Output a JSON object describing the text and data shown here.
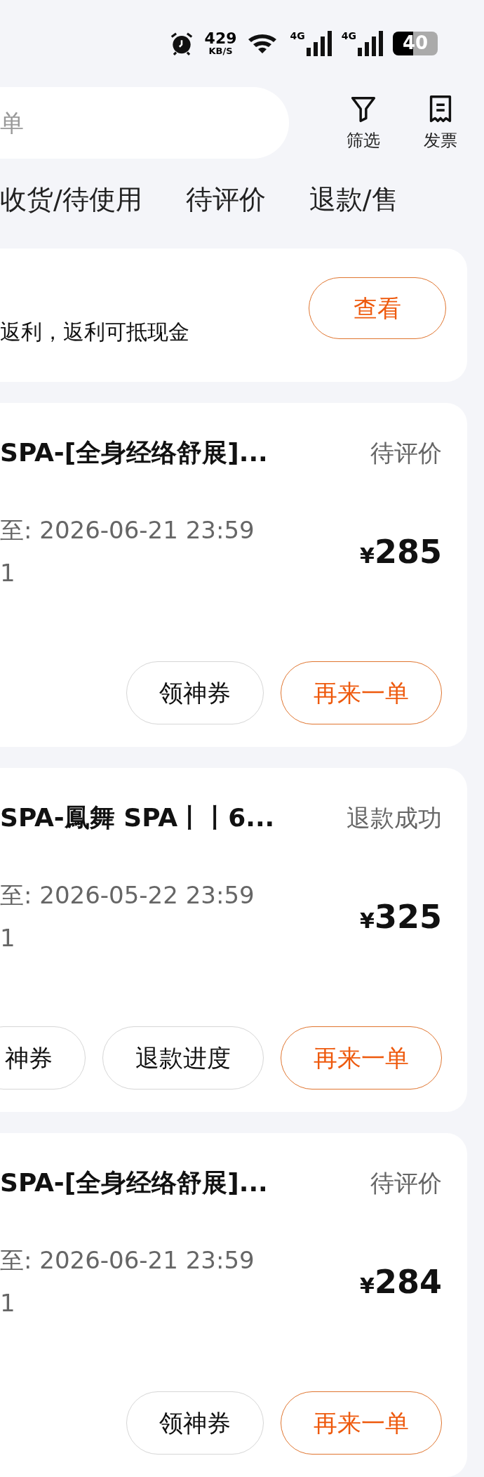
{
  "status_bar": {
    "speed": "429",
    "speed_unit": "KB/S",
    "networks": [
      "4G",
      "4G"
    ],
    "battery": "40"
  },
  "search": {
    "placeholder": "单"
  },
  "actions": [
    {
      "label": "筛选",
      "kind": "filter"
    },
    {
      "label": "发票",
      "kind": "invoice"
    }
  ],
  "tabs": [
    {
      "label": "收货/待使用",
      "selected": false
    },
    {
      "label": "待评价",
      "selected": false
    },
    {
      "label": "退款/售",
      "selected": false
    }
  ],
  "banner": {
    "text": "返利，返利可抵现金",
    "button": "查看"
  },
  "orders": [
    {
      "title": "SPA-[全身经络舒展]...",
      "status": "待评价",
      "validity": "至: 2026-06-21 23:59",
      "quantity": "1",
      "currency": "¥",
      "price": "285",
      "buttons": [
        {
          "label": "领神券",
          "kind": "plain"
        },
        {
          "label": "再来一单",
          "kind": "primary"
        }
      ]
    },
    {
      "title": "SPA-鳳舞 SPA丨丨6...",
      "status": "退款成功",
      "validity": "至: 2026-05-22 23:59",
      "quantity": "1",
      "currency": "¥",
      "price": "325",
      "buttons": [
        {
          "label": "神券",
          "kind": "plain"
        },
        {
          "label": "退款进度",
          "kind": "plain"
        },
        {
          "label": "再来一单",
          "kind": "primary"
        }
      ]
    },
    {
      "title": "SPA-[全身经络舒展]...",
      "status": "待评价",
      "validity": "至: 2026-06-21 23:59",
      "quantity": "1",
      "currency": "¥",
      "price": "284",
      "buttons": [
        {
          "label": "领神券",
          "kind": "plain"
        },
        {
          "label": "再来一单",
          "kind": "primary"
        }
      ]
    }
  ]
}
